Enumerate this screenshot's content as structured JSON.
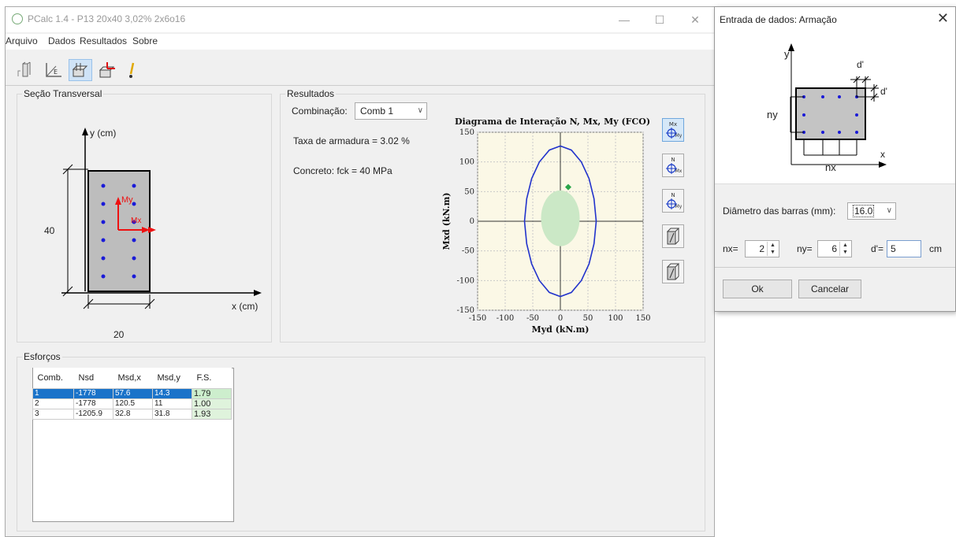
{
  "main_window": {
    "title": "PCalc 1.4 - P13 20x40 3,02% 2x6o16",
    "minimize": "—",
    "maximize": "☐",
    "close": "✕"
  },
  "menu": [
    "Arquivo",
    "Dados",
    "Resultados",
    "Sobre"
  ],
  "toolbar": {
    "icons": [
      "section-tool-icon",
      "axes-tool-icon",
      "reinforcement-tool-icon",
      "loads-tool-icon",
      "run-tool-icon"
    ]
  },
  "secao": {
    "title": "Seção Transversal",
    "y_label": "y (cm)",
    "x_label": "x (cm)",
    "height_label": "40",
    "width_label": "20",
    "my_label": "My",
    "mx_label": "Mx"
  },
  "resultados": {
    "title": "Resultados",
    "combinacao_label": "Combinação:",
    "combinacao_value": "Comb 1",
    "taxa": "Taxa de armadura = 3.02 %",
    "concreto": "Concreto: fck = 40 MPa"
  },
  "chart_data": {
    "type": "line",
    "title": "Diagrama de Interação N, Mx, My (FCO)",
    "xlabel": "Myd  (kN.m)",
    "ylabel": "Mxd  (kN.m)",
    "xlim": [
      -150,
      150
    ],
    "ylim": [
      -150,
      150
    ],
    "xticks": [
      -150,
      -100,
      -50,
      0,
      50,
      100,
      150
    ],
    "yticks": [
      150,
      100,
      50,
      0,
      -50,
      -100,
      -150
    ],
    "grid": true,
    "series": [
      {
        "x": [
          0,
          20,
          38,
          52,
          61,
          65,
          61,
          52,
          38,
          20,
          0,
          -20,
          -38,
          -52,
          -61,
          -65,
          -61,
          -52,
          -38,
          -20,
          0
        ],
        "y": [
          127,
          120,
          100,
          72,
          38,
          0,
          -38,
          -72,
          -100,
          -120,
          -127,
          -120,
          -100,
          -72,
          -38,
          0,
          38,
          72,
          100,
          120,
          127
        ]
      }
    ],
    "point": {
      "x": 14.3,
      "y": 57.6
    },
    "safe_region": {
      "cx": 0,
      "cy": 5,
      "rx": 35,
      "ry": 47
    },
    "colors": {
      "curve": "#2233cc",
      "point": "#2aa54a",
      "region": "#cbe8c6",
      "background": "#fbf8e6"
    }
  },
  "side_buttons": [
    "mx-my-view-icon",
    "n-mx-view-icon",
    "n-my-view-icon",
    "section-3d-icon",
    "section-3d-alt-icon"
  ],
  "side_button_labels": [
    [
      "Mx",
      "My"
    ],
    [
      "N",
      "Mx"
    ],
    [
      "N",
      "My"
    ],
    [
      "",
      ""
    ],
    [
      "",
      ""
    ]
  ],
  "esforcos": {
    "title": "Esforços",
    "headers": [
      "Comb.",
      "Nsd",
      "Msd,x",
      "Msd,y",
      "F.S."
    ],
    "rows": [
      [
        "1",
        "-1778",
        "57.6",
        "14.3",
        "1.79"
      ],
      [
        "2",
        "-1778",
        "120.5",
        "11",
        "1.00"
      ],
      [
        "3",
        "-1205.9",
        "32.8",
        "31.8",
        "1.93"
      ]
    ]
  },
  "dialog": {
    "title": "Entrada de dados: Armação",
    "close": "✕",
    "diagram_labels": {
      "y": "y",
      "x": "x",
      "d1": "d'",
      "d2": "d'",
      "ny": "ny",
      "nx": "nx"
    },
    "diametro_label": "Diâmetro das barras (mm):",
    "diametro_value": "16.0",
    "nx_label": "nx=",
    "nx_value": "2",
    "ny_label": "ny=",
    "ny_value": "6",
    "d_label": "d'=",
    "d_value": "5",
    "cm_label": "cm",
    "ok": "Ok",
    "cancelar": "Cancelar"
  }
}
